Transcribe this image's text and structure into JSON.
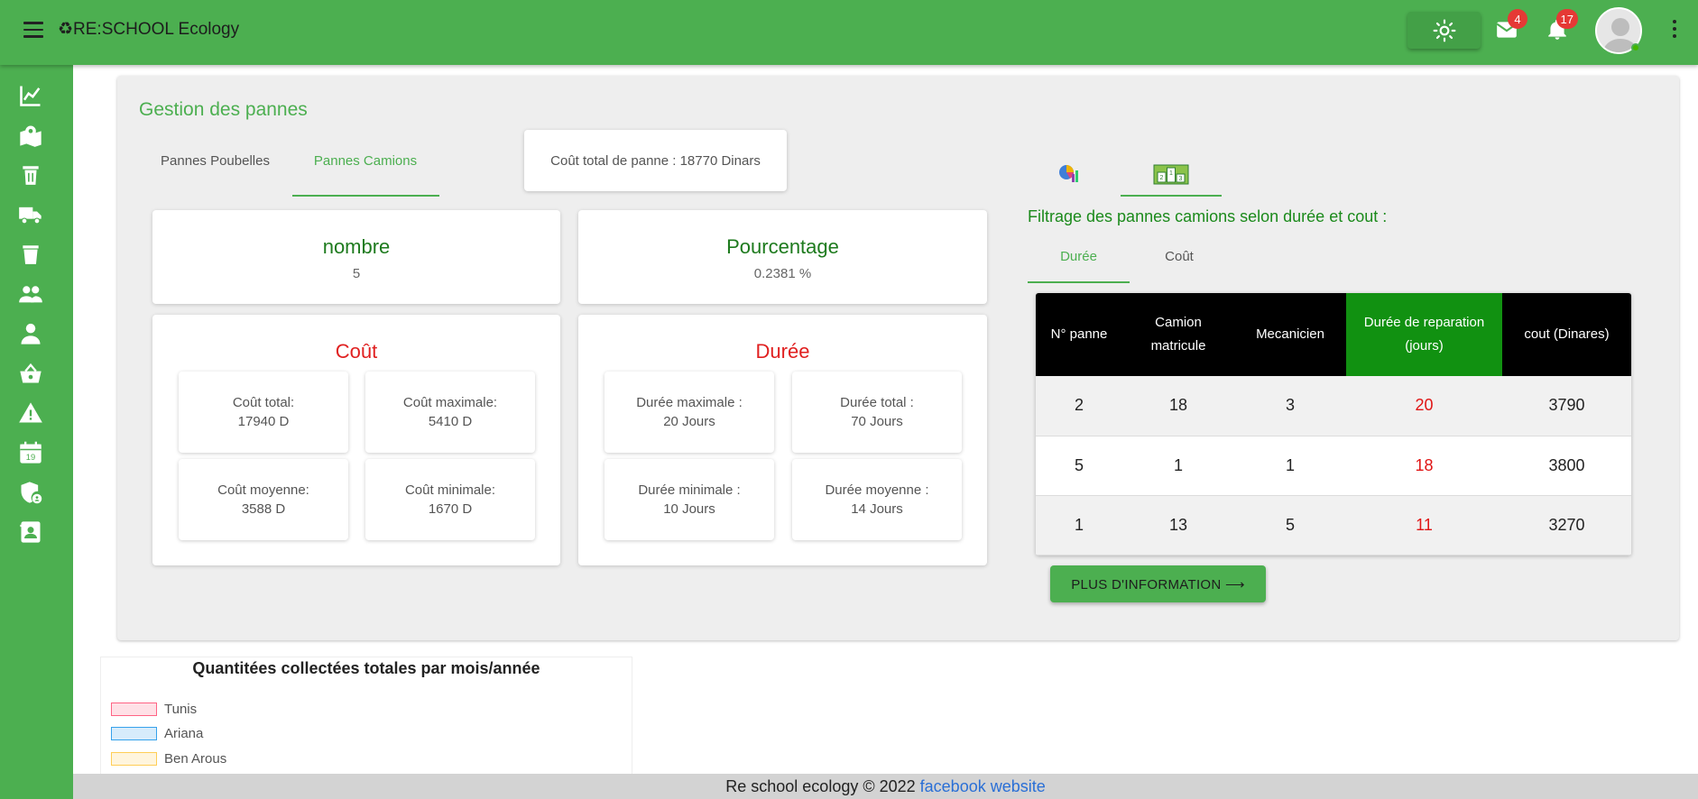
{
  "app": {
    "title": "♻RE:SCHOOL Ecology"
  },
  "header": {
    "mail_badge": "4",
    "notif_badge": "17"
  },
  "sidebar": {
    "items": [
      {
        "icon": "chart-line-icon"
      },
      {
        "icon": "map-marker-icon"
      },
      {
        "icon": "trash-can-icon"
      },
      {
        "icon": "truck-icon"
      },
      {
        "icon": "delete-bin-icon"
      },
      {
        "icon": "people-icon"
      },
      {
        "icon": "person-icon"
      },
      {
        "icon": "basket-icon"
      },
      {
        "icon": "warning-icon"
      },
      {
        "icon": "calendar-icon"
      },
      {
        "icon": "security-icon"
      },
      {
        "icon": "contact-card-icon"
      }
    ],
    "calendar_day": "19"
  },
  "main": {
    "title": "Gestion des pannes",
    "tabs": [
      {
        "label": "Pannes Poubelles"
      },
      {
        "label": "Pannes Camions"
      }
    ],
    "total_cost": "Coût total de panne : 18770 Dinars",
    "nombre": {
      "title": "nombre",
      "value": "5"
    },
    "pourcentage": {
      "title": "Pourcentage",
      "value": "0.2381 %"
    },
    "cout": {
      "title": "Coût",
      "total_label": "Coût total:",
      "total_value": "17940 D",
      "max_label": "Coût maximale:",
      "max_value": "5410 D",
      "moy_label": "Coût moyenne:",
      "moy_value": "3588 D",
      "min_label": "Coût minimale:",
      "min_value": "1670 D"
    },
    "duree": {
      "title": "Durée",
      "max_label": "Durée maximale :",
      "max_value": "20 Jours",
      "total_label": "Durée total :",
      "total_value": "70 Jours",
      "min_label": "Durée minimale :",
      "min_value": "10 Jours",
      "moy_label": "Durée moyenne :",
      "moy_value": "14 Jours"
    }
  },
  "filter": {
    "title": "Filtrage des pannes camions selon durée et cout :",
    "tabs": [
      {
        "label": "Durée"
      },
      {
        "label": "Coût"
      }
    ],
    "table": {
      "headers": [
        "N° panne",
        "Camion matricule",
        "Mecanicien",
        "Durée de reparation  (jours)",
        "cout (Dinares)"
      ],
      "rows": [
        [
          "2",
          "18",
          "3",
          "20",
          "3790"
        ],
        [
          "5",
          "1",
          "1",
          "18",
          "3800"
        ],
        [
          "1",
          "13",
          "5",
          "11",
          "3270"
        ]
      ]
    },
    "more_button": "PLUS D'INFORMATION ⟶"
  },
  "collect_chart": {
    "title": "Quantitées collectées totales par mois/année",
    "legend": [
      {
        "name": "Tunis",
        "color": "#ff6384"
      },
      {
        "name": "Ariana",
        "color": "#36a2eb"
      },
      {
        "name": "Ben Arous",
        "color": "#ffce56"
      }
    ]
  },
  "footer": {
    "text": "Re school ecology © 2022",
    "link": "facebook website"
  }
}
